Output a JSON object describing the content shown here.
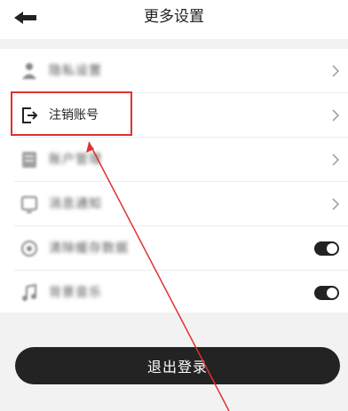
{
  "header": {
    "title": "更多设置",
    "back_icon": "arrow-left-icon"
  },
  "settings": {
    "items": [
      {
        "label": "隐私设置",
        "icon": "person-icon",
        "blurred": true,
        "control": "chevron"
      },
      {
        "label": "注销账号",
        "icon": "logout-icon",
        "blurred": false,
        "control": "chevron"
      },
      {
        "label": "账户管理",
        "icon": "file-icon",
        "blurred": true,
        "control": "chevron"
      },
      {
        "label": "消息通知",
        "icon": "badge-icon",
        "blurred": true,
        "control": "chevron"
      },
      {
        "label": "清除缓存数据",
        "icon": "gear-icon",
        "blurred": true,
        "control": "toggle",
        "toggle_on": true
      },
      {
        "label": "背景音乐",
        "icon": "music-icon",
        "blurred": true,
        "control": "toggle",
        "toggle_on": true
      }
    ]
  },
  "footer": {
    "logout_label": "退出登录"
  },
  "annotation": {
    "highlight_color": "#e03131"
  }
}
